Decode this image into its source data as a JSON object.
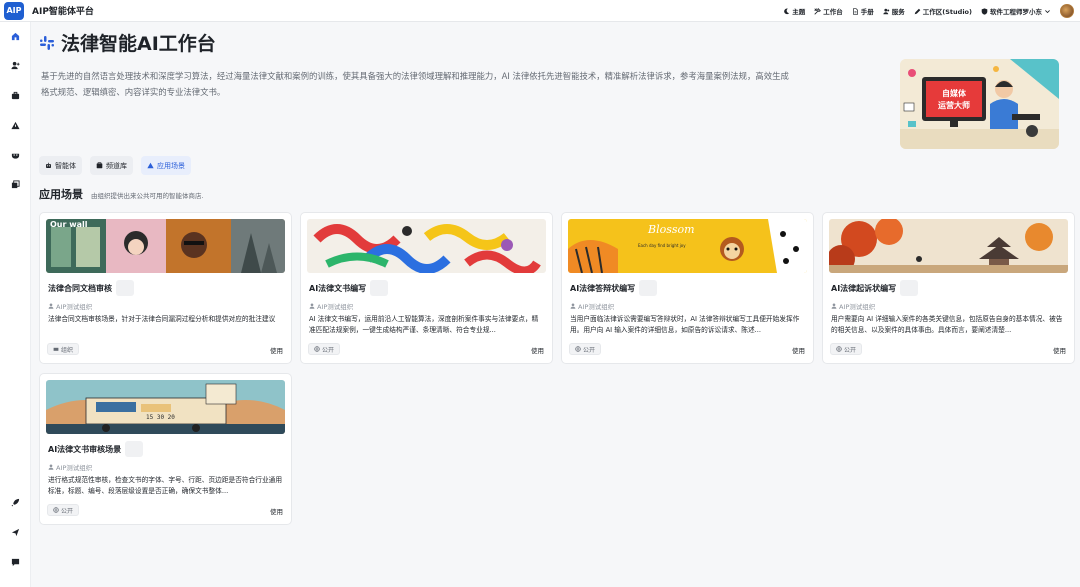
{
  "topbar": {
    "logo": "AIP",
    "brand": "AIP智能体平台",
    "nav": [
      {
        "label": "主题",
        "icon": "moon-icon"
      },
      {
        "label": "工作台",
        "icon": "tools-icon"
      },
      {
        "label": "手册",
        "icon": "doc-icon"
      },
      {
        "label": "服务",
        "icon": "users-icon"
      },
      {
        "label": "工作区(Studio)",
        "icon": "pen-icon"
      },
      {
        "label": "软件工程师罗小东",
        "icon": "shield-icon"
      }
    ]
  },
  "header": {
    "title": "法律智能AI工作台",
    "description": "基于先进的自然语言处理技术和深度学习算法，经过海量法律文献和案例的训练，使其具备强大的法律领域理解和推理能力，AI 法律依托先进智能技术，精准解析法律诉求，参考海量案例法规，高效生成格式规范、逻辑缜密、内容详实的专业法律文书。",
    "hero_text": "自媒体\n运营大师"
  },
  "tabs": [
    {
      "label": "智能体",
      "icon": "robot-icon",
      "active": false
    },
    {
      "label": "频道库",
      "icon": "library-icon",
      "active": false
    },
    {
      "label": "应用场景",
      "icon": "scene-icon",
      "active": true
    }
  ],
  "section": {
    "title": "应用场景",
    "subtitle": "由组织提供出来公共可用的智能体商店."
  },
  "cards": [
    {
      "title": "法律合同文档审核",
      "org": "AIP测试组织",
      "desc": "法律合同文档审核场景，针对于法律合同漏洞过程分析和提供对应的批注建议",
      "badge": "组织",
      "use": "使用"
    },
    {
      "title": "AI法律文书编写",
      "org": "AIP测试组织",
      "desc": "AI 法律文书编写，运用前沿人工智能算法，深度剖析案件事实与法律要点，精准匹配法规案例，一键生成结构严谨、条理清晰、符合专业规...",
      "badge": "公开",
      "use": "使用"
    },
    {
      "title": "AI法律答辩状编写",
      "org": "AIP测试组织",
      "desc": "当用户面临法律诉讼需要编写答辩状时，AI 法律答辩状编写工具便开始发挥作用。用户向 AI 输入案件的详细信息，如原告的诉讼请求、陈述...",
      "badge": "公开",
      "use": "使用"
    },
    {
      "title": "AI法律起诉状编写",
      "org": "AIP测试组织",
      "desc": "用户需要向 AI 详细输入案件的各类关键信息，包括原告自身的基本情况、被告的相关信息、以及案件的具体事由。具体而言，要阐述清楚...",
      "badge": "公开",
      "use": "使用"
    },
    {
      "title": "AI法律文书审核场景",
      "org": "AIP测试组织",
      "desc": "进行格式规范性审核，检查文书的字体、字号、行距、页边距是否符合行业通用标准，标题、编号、段落层级设置是否正确，确保文书整体...",
      "badge": "公开",
      "use": "使用"
    }
  ],
  "colors": {
    "accent": "#2b5fd9",
    "logo_bg": "#1f5fd1"
  }
}
